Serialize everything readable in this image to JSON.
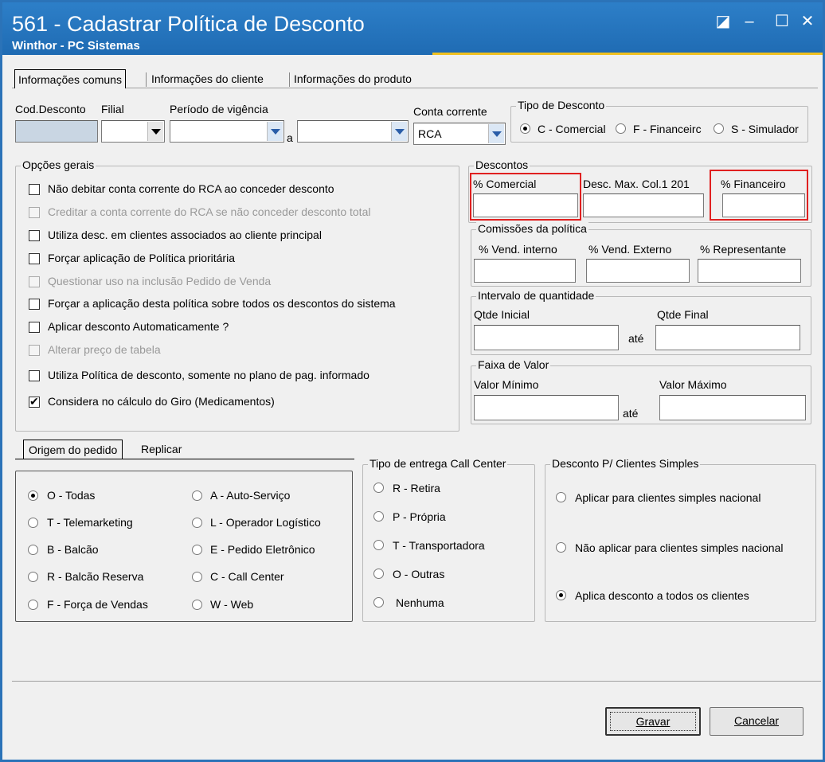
{
  "window": {
    "title": "561 - Cadastrar Política de Desconto",
    "subtitle": "Winthor - PC Sistemas",
    "controls": {
      "restore": "◪",
      "minimize": "–",
      "maximize": "☐",
      "close": "✕"
    }
  },
  "tabs": [
    "Informações comuns",
    "Informações do cliente",
    "Informações do produto"
  ],
  "header": {
    "cod_desconto_label": "Cod.Desconto",
    "filial_label": "Filial",
    "periodo_label": "Período de vigência",
    "periodo_sep": "a",
    "conta_corrente_label": "Conta corrente",
    "conta_corrente_value": "RCA"
  },
  "tipo_desconto": {
    "label": "Tipo de Desconto",
    "options": [
      "C - Comercial",
      "F - Financeirc",
      "S - Simulador"
    ],
    "selected": 0
  },
  "opcoes_gerais": {
    "label": "Opções gerais",
    "items": [
      {
        "label": "Não debitar conta corrente do RCA ao conceder desconto",
        "checked": false,
        "enabled": true
      },
      {
        "label": "Creditar a conta corrente do RCA se não conceder desconto total",
        "checked": false,
        "enabled": false
      },
      {
        "label": "Utiliza desc. em clientes associados ao cliente principal",
        "checked": false,
        "enabled": true
      },
      {
        "label": "Forçar aplicação de Política prioritária",
        "checked": false,
        "enabled": true
      },
      {
        "label": "Questionar uso na inclusão Pedido de Venda",
        "checked": false,
        "enabled": false
      },
      {
        "label": "Forçar a aplicação desta política sobre todos os descontos do sistema",
        "checked": false,
        "enabled": true
      },
      {
        "label": "Aplicar desconto Automaticamente ?",
        "checked": false,
        "enabled": true
      },
      {
        "label": "Alterar preço de tabela",
        "checked": false,
        "enabled": false
      },
      {
        "label": "Utiliza Política de desconto, somente no plano de pag. informado",
        "checked": false,
        "enabled": true
      },
      {
        "label": "Considera no cálculo do Giro (Medicamentos)",
        "checked": true,
        "enabled": true
      }
    ]
  },
  "descontos": {
    "label": "Descontos",
    "comercial": "% Comercial",
    "desc_max": "Desc. Max. Col.1 201",
    "financeiro": "% Financeiro"
  },
  "comissoes": {
    "label": "Comissões da política",
    "interno": "% Vend. interno",
    "externo": "% Vend. Externo",
    "representante": "% Representante"
  },
  "intervalo": {
    "label": "Intervalo de quantidade",
    "inicial": "Qtde Inicial",
    "final": "Qtde Final",
    "ate": "até"
  },
  "faixa": {
    "label": "Faixa de Valor",
    "minimo": "Valor Mínimo",
    "maximo": "Valor Máximo",
    "ate": "até"
  },
  "lower_tabs": [
    "Origem do pedido",
    "Replicar"
  ],
  "origem": {
    "options": [
      "O - Todas",
      "T - Telemarketing",
      "B - Balcão",
      "R - Balcão Reserva",
      "F - Força de Vendas",
      "A - Auto-Serviço",
      "L - Operador Logístico",
      "E - Pedido Eletrônico",
      "C - Call Center",
      "W - Web"
    ],
    "selected": 0
  },
  "tipo_entrega": {
    "label": "Tipo de entrega Call Center",
    "options": [
      "R - Retira",
      "P - Própria",
      "T - Transportadora",
      "O - Outras",
      "Nenhuma"
    ],
    "selected": -1
  },
  "clientes_simples": {
    "label": "Desconto P/ Clientes Simples",
    "options": [
      "Aplicar para clientes simples nacional",
      "Não aplicar para clientes simples nacional",
      "Aplica desconto a todos os clientes"
    ],
    "selected": 2
  },
  "buttons": {
    "gravar": "Gravar",
    "cancelar": "Cancelar"
  }
}
